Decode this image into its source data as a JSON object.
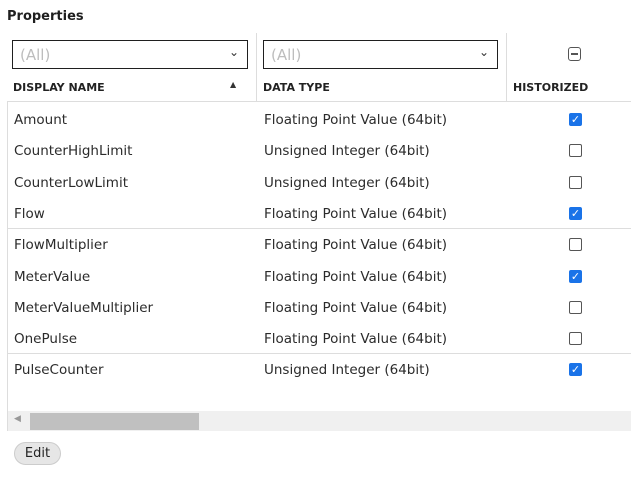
{
  "title": "Properties",
  "filters": {
    "name": "(All)",
    "type": "(All)"
  },
  "columns": {
    "name": "DISPLAY NAME",
    "type": "DATA TYPE",
    "historized": "HISTORIZED"
  },
  "rows": [
    {
      "name": "Amount",
      "type": "Floating Point Value (64bit)",
      "historized": true
    },
    {
      "name": "CounterHighLimit",
      "type": "Unsigned Integer (64bit)",
      "historized": false
    },
    {
      "name": "CounterLowLimit",
      "type": "Unsigned Integer (64bit)",
      "historized": false
    },
    {
      "name": "Flow",
      "type": "Floating Point Value (64bit)",
      "historized": true
    },
    {
      "name": "FlowMultiplier",
      "type": "Floating Point Value (64bit)",
      "historized": false
    },
    {
      "name": "MeterValue",
      "type": "Floating Point Value (64bit)",
      "historized": true
    },
    {
      "name": "MeterValueMultiplier",
      "type": "Floating Point Value (64bit)",
      "historized": false
    },
    {
      "name": "OnePulse",
      "type": "Floating Point Value (64bit)",
      "historized": false
    },
    {
      "name": "PulseCounter",
      "type": "Unsigned Integer (64bit)",
      "historized": true
    }
  ],
  "edit_label": "Edit"
}
